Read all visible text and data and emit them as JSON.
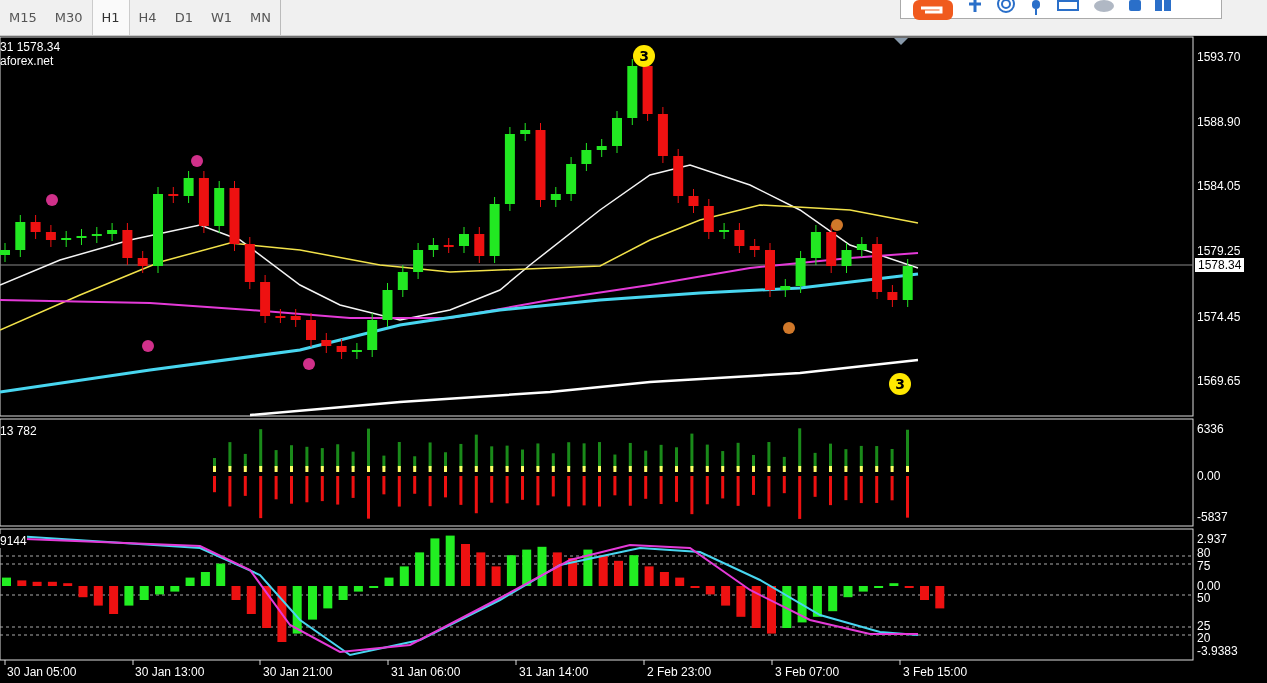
{
  "timeframes": [
    {
      "label": "M15",
      "selected": false
    },
    {
      "label": "M30",
      "selected": false
    },
    {
      "label": "H1",
      "selected": true
    },
    {
      "label": "H4",
      "selected": false
    },
    {
      "label": "D1",
      "selected": false
    },
    {
      "label": "W1",
      "selected": false
    },
    {
      "label": "MN",
      "selected": false
    }
  ],
  "chart": {
    "info_line": "31 1578.34",
    "broker": "aforex.net",
    "price_axis": [
      "1593.70",
      "1588.90",
      "1584.05",
      "1579.25",
      "1574.45",
      "1569.65"
    ],
    "current_price": "1578.34",
    "markers": [
      "3",
      "3"
    ]
  },
  "volume_panel": {
    "label": "13 782",
    "axis": [
      "6336",
      "0.00",
      "-5837"
    ]
  },
  "oscillator_panel": {
    "label": "9144",
    "axis": [
      "2.937",
      "80",
      "75",
      "0.00",
      "50",
      "25",
      "20",
      "-3.9383"
    ]
  },
  "time_axis": [
    "30 Jan 05:00",
    "30 Jan 13:00",
    "30 Jan 21:00",
    "31 Jan 06:00",
    "31 Jan 14:00",
    "2 Feb 23:00",
    "3 Feb 07:00",
    "3 Feb 15:00"
  ]
}
